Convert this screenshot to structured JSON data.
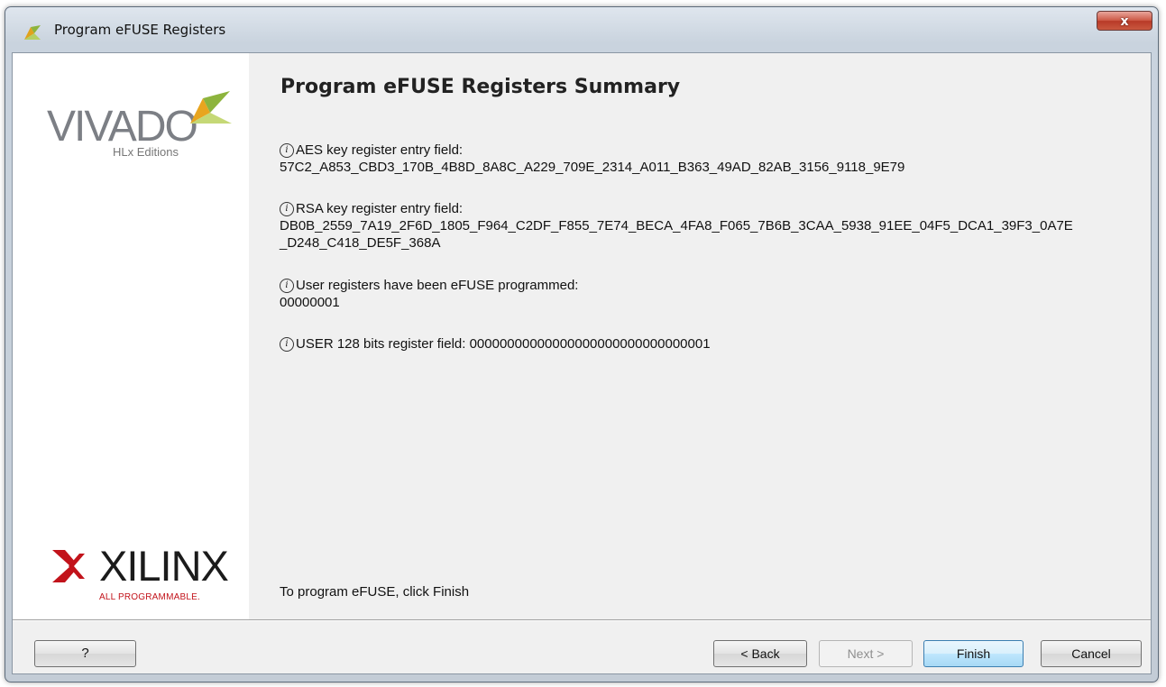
{
  "window": {
    "title": "Program eFUSE Registers",
    "close_label": "x"
  },
  "sidebar": {
    "vivado_logo_text": "VIVADO",
    "vivado_logo_subtitle": "HLx Editions",
    "xilinx_logo_text": "XILINX",
    "xilinx_logo_tagline": "ALL PROGRAMMABLE."
  },
  "main": {
    "title": "Program eFUSE Registers Summary",
    "items": [
      {
        "label": "AES key register entry field:",
        "values": [
          "57C2_A853_CBD3_170B_4B8D_8A8C_A229_709E_2314_A011_B363_49AD_82AB_3156_9118_9E79"
        ]
      },
      {
        "label": "RSA key register entry field:",
        "values": [
          "DB0B_2559_7A19_2F6D_1805_F964_C2DF_F855_7E74_BECA_4FA8_F065_7B6B_3CAA_5938_91EE_04F5_DCA1_39F3_0A7E",
          "_D248_C418_DE5F_368A"
        ]
      },
      {
        "label": "User registers have been eFUSE programmed:",
        "values": [
          "00000001"
        ]
      },
      {
        "label": "USER 128 bits register field: 00000000000000000000000000000001",
        "values": []
      }
    ],
    "footer_note": "To program eFUSE, click Finish"
  },
  "buttons": {
    "help": "?",
    "back": "< Back",
    "next": "Next >",
    "finish": "Finish",
    "cancel": "Cancel"
  },
  "colors": {
    "accent_leaf": "#8db43d",
    "xilinx_red": "#c2131b"
  }
}
